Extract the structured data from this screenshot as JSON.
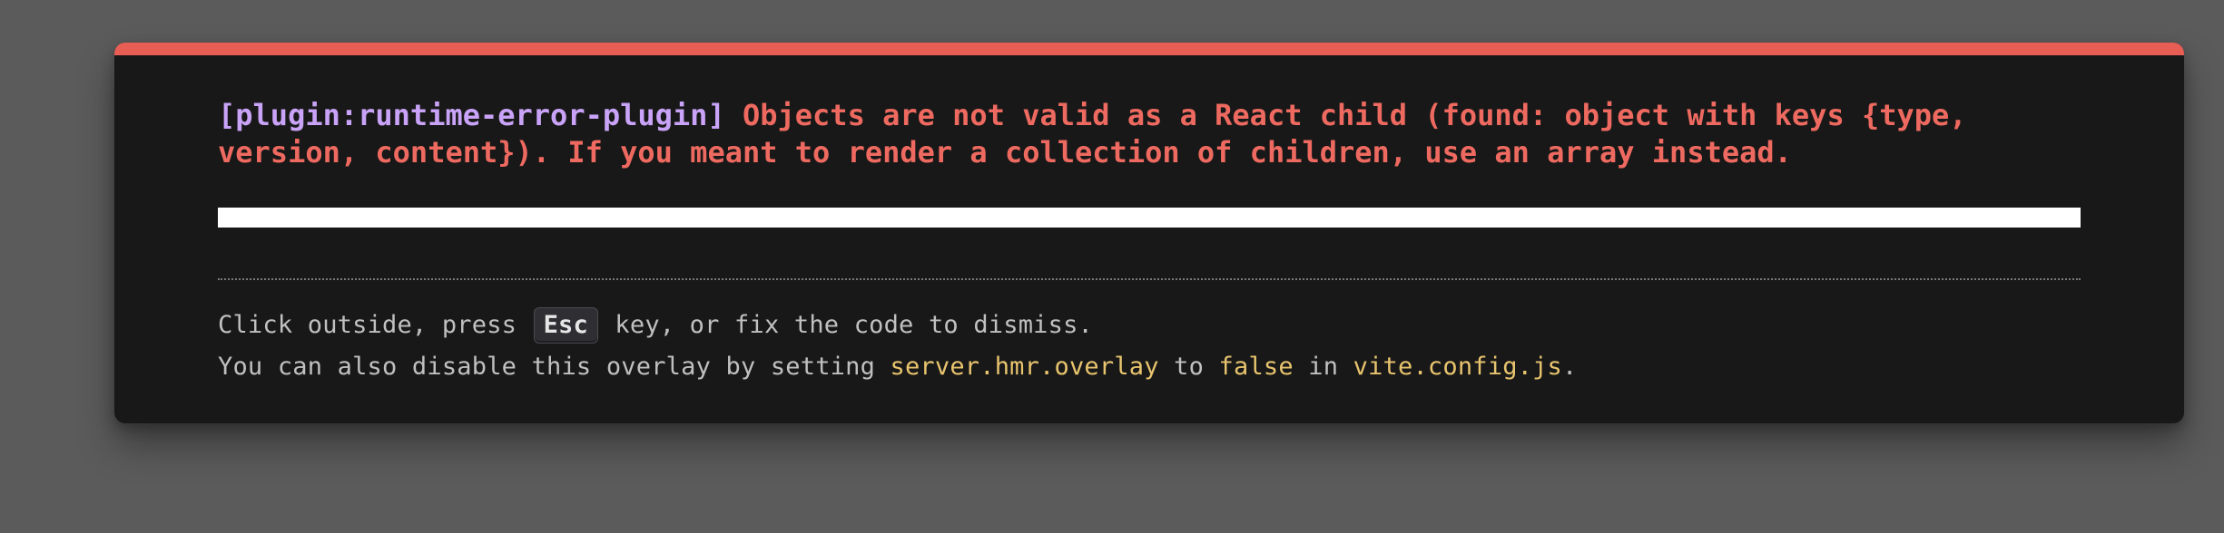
{
  "overlay": {
    "plugin_tag": "[plugin:runtime-error-plugin]",
    "error_message": "Objects are not valid as a React child (found: object with keys {type, version, content}). If you meant to render a collection of children, use an array instead."
  },
  "tips": {
    "line1_before": "Click outside, press ",
    "esc_key": "Esc",
    "line1_after": " key, or fix the code to dismiss.",
    "line2_before": "You can also disable this overlay by setting ",
    "setting_name": "server.hmr.overlay",
    "line2_to": " to ",
    "setting_value": "false",
    "line2_in": " in ",
    "config_file": "vite.config.js",
    "line2_end": "."
  },
  "colors": {
    "accent": "#e85e55",
    "error_text": "#ee6a60",
    "plugin_text": "#c9a3f7",
    "code_text": "#e8c46e",
    "panel_bg": "#181818",
    "backdrop": "#5b5b5b"
  }
}
